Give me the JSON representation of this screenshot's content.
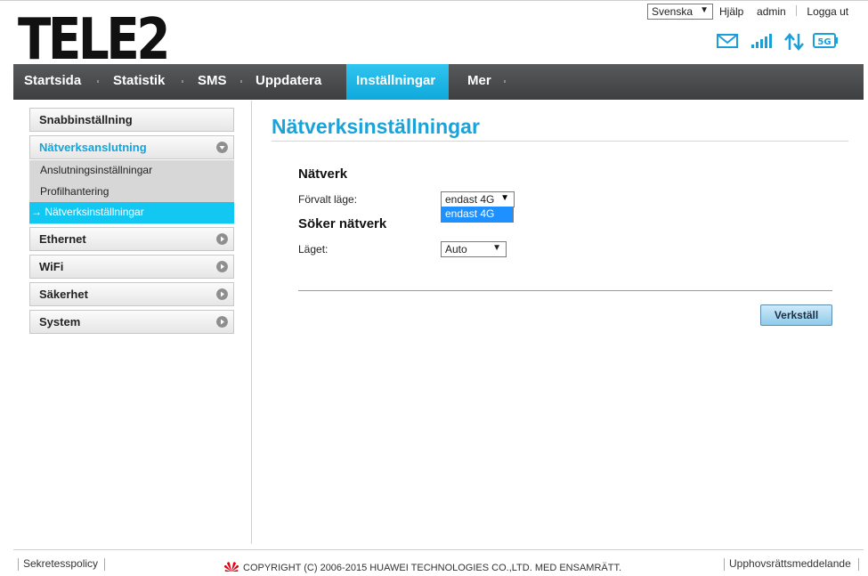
{
  "header": {
    "logo_text": "TELE2",
    "language": "Svenska",
    "links": [
      "Hjälp",
      "admin",
      "Logga ut"
    ],
    "status_icons": [
      "envelope-icon",
      "signal-strength-icon",
      "data-transfer-icon",
      "network-5g-icon"
    ],
    "network_badge": "5G"
  },
  "nav": {
    "items": [
      "Startsida",
      "Statistik",
      "SMS",
      "Uppdatera",
      "Inställningar",
      "Mer"
    ],
    "active": "Inställningar"
  },
  "sidebar": {
    "quick_setup": "Snabbinställning",
    "network_connection": "Nätverksanslutning",
    "sub_items": [
      "Anslutningsinställningar",
      "Profilhantering",
      "Nätverksinställningar"
    ],
    "active_sub_prefix": "→",
    "ethernet": "Ethernet",
    "wifi": "WiFi",
    "security": "Säkerhet",
    "system": "System"
  },
  "content": {
    "title": "Nätverksinställningar",
    "network_section": "Nätverk",
    "preferred_mode_label": "Förvalt läge:",
    "preferred_mode_value": "endast 4G",
    "preferred_mode_options": [
      "endast 4G"
    ],
    "search_section": "Söker nätverk",
    "mode_label": "Läget:",
    "mode_value": "Auto",
    "apply_button": "Verkställ"
  },
  "footer": {
    "privacy": "Sekretesspolicy",
    "copyright": "COPYRIGHT (C) 2006-2015 HUAWEI TECHNOLOGIES CO.,LTD. MED ENSAMRÄTT.",
    "copyright_notice": "Upphovsrättsmeddelande"
  },
  "colors": {
    "accent": "#12a5db",
    "nav_bg": "#4a4c4e",
    "active_sub": "#12c8f2"
  }
}
